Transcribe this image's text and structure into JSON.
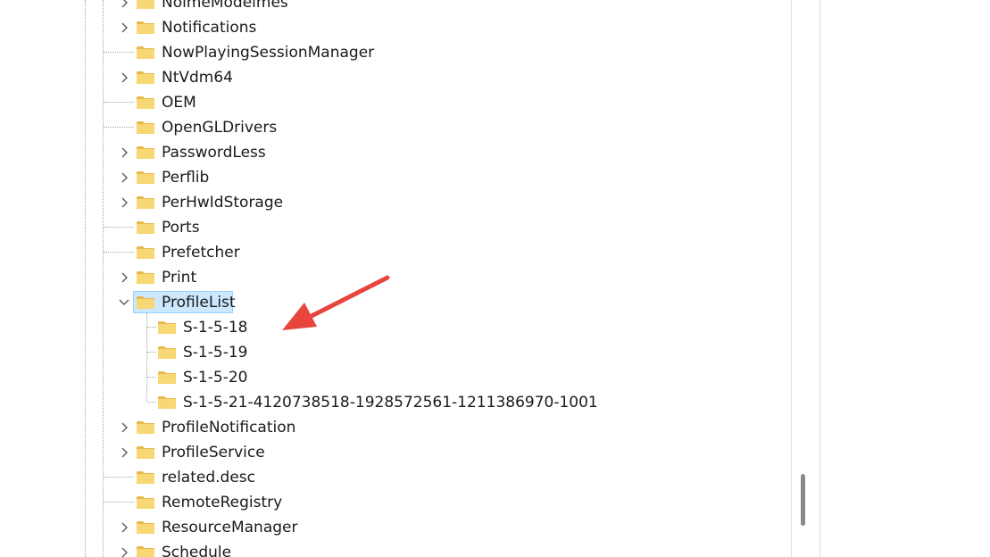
{
  "registry_tree": {
    "items": [
      {
        "label": "NolmeModelmes",
        "expandable": true,
        "depth": 0
      },
      {
        "label": "Notifications",
        "expandable": true,
        "depth": 0
      },
      {
        "label": "NowPlayingSessionManager",
        "expandable": false,
        "depth": 0
      },
      {
        "label": "NtVdm64",
        "expandable": true,
        "depth": 0
      },
      {
        "label": "OEM",
        "expandable": false,
        "depth": 0
      },
      {
        "label": "OpenGLDrivers",
        "expandable": false,
        "depth": 0
      },
      {
        "label": "PasswordLess",
        "expandable": true,
        "depth": 0
      },
      {
        "label": "Perflib",
        "expandable": true,
        "depth": 0
      },
      {
        "label": "PerHwIdStorage",
        "expandable": true,
        "depth": 0
      },
      {
        "label": "Ports",
        "expandable": false,
        "depth": 0
      },
      {
        "label": "Prefetcher",
        "expandable": false,
        "depth": 0
      },
      {
        "label": "Print",
        "expandable": true,
        "depth": 0
      },
      {
        "label": "ProfileList",
        "expandable": true,
        "expanded": true,
        "selected": true,
        "depth": 0
      },
      {
        "label": "S-1-5-18",
        "expandable": false,
        "depth": 1
      },
      {
        "label": "S-1-5-19",
        "expandable": false,
        "depth": 1
      },
      {
        "label": "S-1-5-20",
        "expandable": false,
        "depth": 1
      },
      {
        "label": "S-1-5-21-4120738518-1928572561-1211386970-1001",
        "expandable": false,
        "depth": 1
      },
      {
        "label": "ProfileNotification",
        "expandable": true,
        "depth": 0
      },
      {
        "label": "ProfileService",
        "expandable": true,
        "depth": 0
      },
      {
        "label": "related.desc",
        "expandable": false,
        "depth": 0
      },
      {
        "label": "RemoteRegistry",
        "expandable": false,
        "depth": 0
      },
      {
        "label": "ResourceManager",
        "expandable": true,
        "depth": 0
      },
      {
        "label": "Schedule",
        "expandable": true,
        "depth": 0
      }
    ]
  },
  "icons": {
    "folder": "folder-icon",
    "expand": "chevron-right-icon",
    "collapse": "chevron-down-icon"
  },
  "colors": {
    "folder_fill": "#f8d775",
    "folder_tab": "#e8b84a",
    "selection_bg": "#cce8ff",
    "selection_border": "#99d1ff",
    "annotation_arrow": "#e8453c",
    "scroll_thumb": "#8a8a8a"
  }
}
